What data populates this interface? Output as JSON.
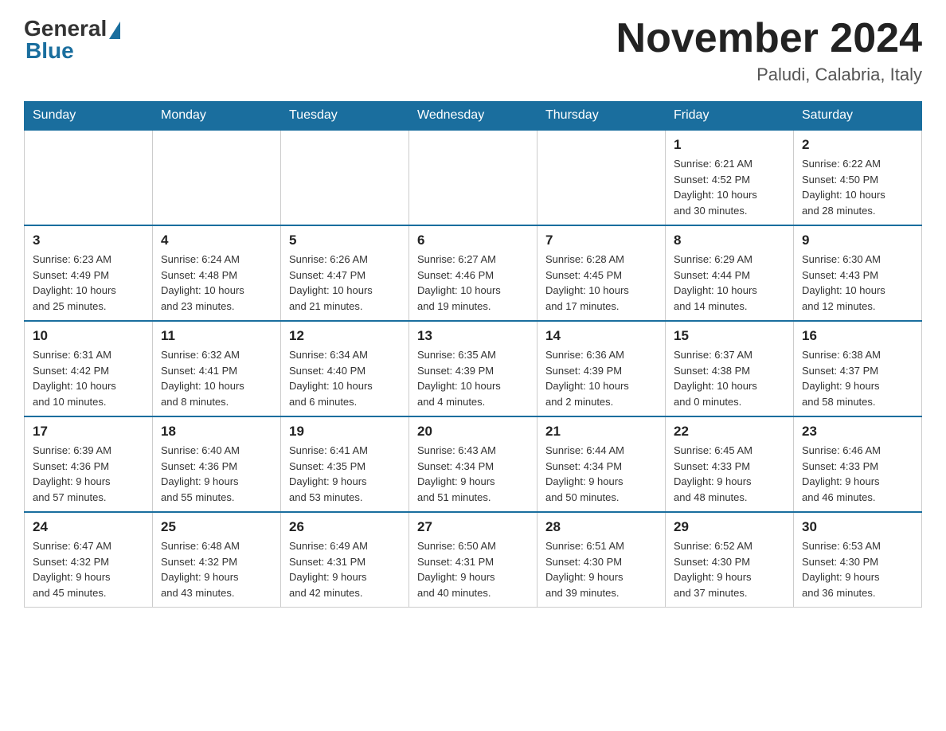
{
  "header": {
    "logo": {
      "general": "General",
      "triangle_symbol": "▲",
      "blue": "Blue"
    },
    "title": "November 2024",
    "location": "Paludi, Calabria, Italy"
  },
  "weekdays": [
    "Sunday",
    "Monday",
    "Tuesday",
    "Wednesday",
    "Thursday",
    "Friday",
    "Saturday"
  ],
  "weeks": [
    [
      {
        "day": "",
        "info": ""
      },
      {
        "day": "",
        "info": ""
      },
      {
        "day": "",
        "info": ""
      },
      {
        "day": "",
        "info": ""
      },
      {
        "day": "",
        "info": ""
      },
      {
        "day": "1",
        "info": "Sunrise: 6:21 AM\nSunset: 4:52 PM\nDaylight: 10 hours\nand 30 minutes."
      },
      {
        "day": "2",
        "info": "Sunrise: 6:22 AM\nSunset: 4:50 PM\nDaylight: 10 hours\nand 28 minutes."
      }
    ],
    [
      {
        "day": "3",
        "info": "Sunrise: 6:23 AM\nSunset: 4:49 PM\nDaylight: 10 hours\nand 25 minutes."
      },
      {
        "day": "4",
        "info": "Sunrise: 6:24 AM\nSunset: 4:48 PM\nDaylight: 10 hours\nand 23 minutes."
      },
      {
        "day": "5",
        "info": "Sunrise: 6:26 AM\nSunset: 4:47 PM\nDaylight: 10 hours\nand 21 minutes."
      },
      {
        "day": "6",
        "info": "Sunrise: 6:27 AM\nSunset: 4:46 PM\nDaylight: 10 hours\nand 19 minutes."
      },
      {
        "day": "7",
        "info": "Sunrise: 6:28 AM\nSunset: 4:45 PM\nDaylight: 10 hours\nand 17 minutes."
      },
      {
        "day": "8",
        "info": "Sunrise: 6:29 AM\nSunset: 4:44 PM\nDaylight: 10 hours\nand 14 minutes."
      },
      {
        "day": "9",
        "info": "Sunrise: 6:30 AM\nSunset: 4:43 PM\nDaylight: 10 hours\nand 12 minutes."
      }
    ],
    [
      {
        "day": "10",
        "info": "Sunrise: 6:31 AM\nSunset: 4:42 PM\nDaylight: 10 hours\nand 10 minutes."
      },
      {
        "day": "11",
        "info": "Sunrise: 6:32 AM\nSunset: 4:41 PM\nDaylight: 10 hours\nand 8 minutes."
      },
      {
        "day": "12",
        "info": "Sunrise: 6:34 AM\nSunset: 4:40 PM\nDaylight: 10 hours\nand 6 minutes."
      },
      {
        "day": "13",
        "info": "Sunrise: 6:35 AM\nSunset: 4:39 PM\nDaylight: 10 hours\nand 4 minutes."
      },
      {
        "day": "14",
        "info": "Sunrise: 6:36 AM\nSunset: 4:39 PM\nDaylight: 10 hours\nand 2 minutes."
      },
      {
        "day": "15",
        "info": "Sunrise: 6:37 AM\nSunset: 4:38 PM\nDaylight: 10 hours\nand 0 minutes."
      },
      {
        "day": "16",
        "info": "Sunrise: 6:38 AM\nSunset: 4:37 PM\nDaylight: 9 hours\nand 58 minutes."
      }
    ],
    [
      {
        "day": "17",
        "info": "Sunrise: 6:39 AM\nSunset: 4:36 PM\nDaylight: 9 hours\nand 57 minutes."
      },
      {
        "day": "18",
        "info": "Sunrise: 6:40 AM\nSunset: 4:36 PM\nDaylight: 9 hours\nand 55 minutes."
      },
      {
        "day": "19",
        "info": "Sunrise: 6:41 AM\nSunset: 4:35 PM\nDaylight: 9 hours\nand 53 minutes."
      },
      {
        "day": "20",
        "info": "Sunrise: 6:43 AM\nSunset: 4:34 PM\nDaylight: 9 hours\nand 51 minutes."
      },
      {
        "day": "21",
        "info": "Sunrise: 6:44 AM\nSunset: 4:34 PM\nDaylight: 9 hours\nand 50 minutes."
      },
      {
        "day": "22",
        "info": "Sunrise: 6:45 AM\nSunset: 4:33 PM\nDaylight: 9 hours\nand 48 minutes."
      },
      {
        "day": "23",
        "info": "Sunrise: 6:46 AM\nSunset: 4:33 PM\nDaylight: 9 hours\nand 46 minutes."
      }
    ],
    [
      {
        "day": "24",
        "info": "Sunrise: 6:47 AM\nSunset: 4:32 PM\nDaylight: 9 hours\nand 45 minutes."
      },
      {
        "day": "25",
        "info": "Sunrise: 6:48 AM\nSunset: 4:32 PM\nDaylight: 9 hours\nand 43 minutes."
      },
      {
        "day": "26",
        "info": "Sunrise: 6:49 AM\nSunset: 4:31 PM\nDaylight: 9 hours\nand 42 minutes."
      },
      {
        "day": "27",
        "info": "Sunrise: 6:50 AM\nSunset: 4:31 PM\nDaylight: 9 hours\nand 40 minutes."
      },
      {
        "day": "28",
        "info": "Sunrise: 6:51 AM\nSunset: 4:30 PM\nDaylight: 9 hours\nand 39 minutes."
      },
      {
        "day": "29",
        "info": "Sunrise: 6:52 AM\nSunset: 4:30 PM\nDaylight: 9 hours\nand 37 minutes."
      },
      {
        "day": "30",
        "info": "Sunrise: 6:53 AM\nSunset: 4:30 PM\nDaylight: 9 hours\nand 36 minutes."
      }
    ]
  ]
}
